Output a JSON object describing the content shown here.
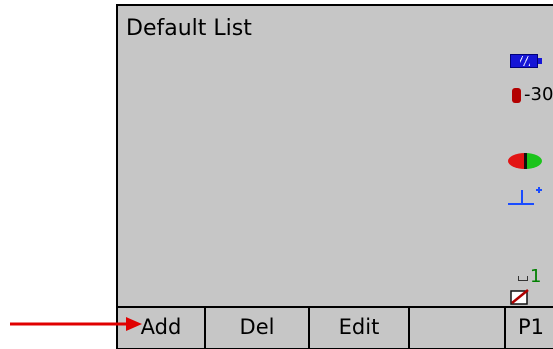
{
  "window": {
    "title": "Default List"
  },
  "status": {
    "battery_icon": "battery-icon",
    "temperature": "-30",
    "sensor_icon": "red-green-sensor-icon",
    "level_icon": "level-icon",
    "count": "1",
    "edit_icon": "edit-icon"
  },
  "softkeys": {
    "add": "Add",
    "del": "Del",
    "edit": "Edit",
    "blank": "",
    "p1": "P1"
  },
  "annotation": {
    "arrow_color": "#e00000"
  }
}
